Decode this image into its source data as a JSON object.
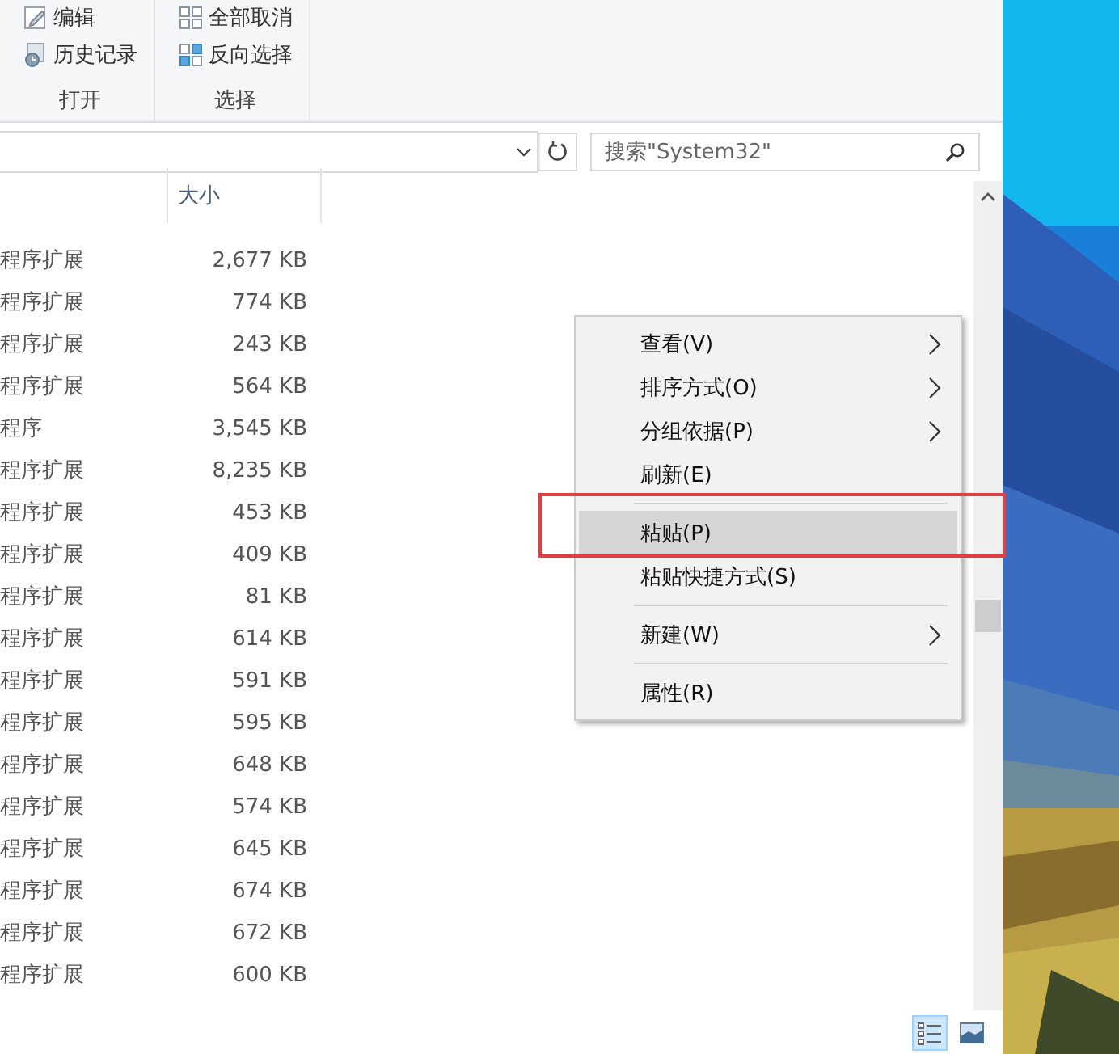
{
  "ribbon": {
    "groups": [
      {
        "label": "打开",
        "items": [
          {
            "label": "编辑",
            "kind": "edit"
          },
          {
            "label": "历史记录",
            "kind": "history"
          }
        ]
      },
      {
        "label": "选择",
        "items": [
          {
            "label": "全部取消",
            "kind": "select-none"
          },
          {
            "label": "反向选择",
            "kind": "invert-select"
          }
        ]
      }
    ]
  },
  "search": {
    "placeholder": "搜索\"System32\""
  },
  "file_list": {
    "columns": [
      "大小"
    ],
    "rows": [
      {
        "type": "程序扩展",
        "size": "2,677 KB"
      },
      {
        "type": "程序扩展",
        "size": "774 KB"
      },
      {
        "type": "程序扩展",
        "size": "243 KB"
      },
      {
        "type": "程序扩展",
        "size": "564 KB"
      },
      {
        "type": "程序",
        "size": "3,545 KB"
      },
      {
        "type": "程序扩展",
        "size": "8,235 KB"
      },
      {
        "type": "程序扩展",
        "size": "453 KB"
      },
      {
        "type": "程序扩展",
        "size": "409 KB"
      },
      {
        "type": "程序扩展",
        "size": "81 KB"
      },
      {
        "type": "程序扩展",
        "size": "614 KB"
      },
      {
        "type": "程序扩展",
        "size": "591 KB"
      },
      {
        "type": "程序扩展",
        "size": "595 KB"
      },
      {
        "type": "程序扩展",
        "size": "648 KB"
      },
      {
        "type": "程序扩展",
        "size": "574 KB"
      },
      {
        "type": "程序扩展",
        "size": "645 KB"
      },
      {
        "type": "程序扩展",
        "size": "674 KB"
      },
      {
        "type": "程序扩展",
        "size": "672 KB"
      },
      {
        "type": "程序扩展",
        "size": "600 KB"
      }
    ]
  },
  "context_menu": {
    "items": [
      {
        "kind": "item",
        "label": "查看(V)",
        "submenu": true,
        "selected": false,
        "framed": false
      },
      {
        "kind": "item",
        "label": "排序方式(O)",
        "submenu": true,
        "selected": false,
        "framed": false
      },
      {
        "kind": "item",
        "label": "分组依据(P)",
        "submenu": true,
        "selected": false,
        "framed": false
      },
      {
        "kind": "item",
        "label": "刷新(E)",
        "submenu": false,
        "selected": false,
        "framed": false
      },
      {
        "kind": "separator"
      },
      {
        "kind": "item",
        "label": "粘贴(P)",
        "submenu": false,
        "selected": true,
        "framed": true
      },
      {
        "kind": "item",
        "label": "粘贴快捷方式(S)",
        "submenu": false,
        "selected": false,
        "framed": false
      },
      {
        "kind": "separator"
      },
      {
        "kind": "item",
        "label": "新建(W)",
        "submenu": true,
        "selected": false,
        "framed": false
      },
      {
        "kind": "separator"
      },
      {
        "kind": "item",
        "label": "属性(R)",
        "submenu": false,
        "selected": false,
        "framed": false
      }
    ]
  },
  "status_bar": {
    "views": [
      {
        "kind": "details",
        "selected": true
      },
      {
        "kind": "thumbnails",
        "selected": false
      }
    ]
  }
}
